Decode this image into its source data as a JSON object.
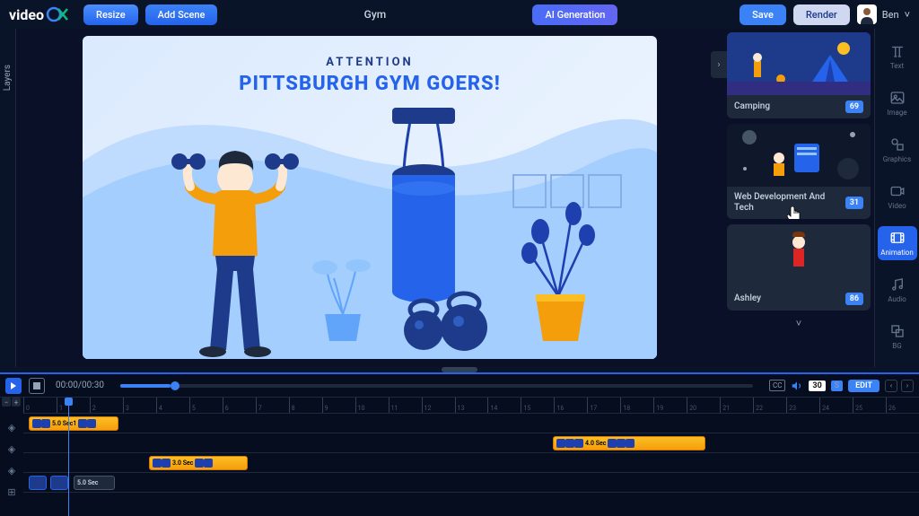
{
  "app": {
    "name": "video",
    "logoSuffix": "XQ"
  },
  "topbar": {
    "resize": "Resize",
    "addScene": "Add Scene",
    "projectTitle": "Gym",
    "aiGeneration": "AI Generation",
    "save": "Save",
    "render": "Render",
    "userName": "Ben"
  },
  "sidebar": {
    "layers": "Layers"
  },
  "canvas": {
    "line1": "ATTENTION",
    "line2": "PITTSBURGH GYM GOERS!"
  },
  "templates": [
    {
      "name": "Camping",
      "count": "69"
    },
    {
      "name": "Web Development And Tech",
      "count": "31"
    },
    {
      "name": "Ashley",
      "count": "86"
    }
  ],
  "tools": [
    {
      "id": "text",
      "label": "Text"
    },
    {
      "id": "image",
      "label": "Image"
    },
    {
      "id": "graphics",
      "label": "Graphics"
    },
    {
      "id": "video",
      "label": "Video"
    },
    {
      "id": "animation",
      "label": "Animation",
      "active": true
    },
    {
      "id": "audio",
      "label": "Audio"
    },
    {
      "id": "bg",
      "label": "BG"
    }
  ],
  "timeline": {
    "current": "00:00",
    "total": "00:30",
    "fps": "30",
    "fpsUnit": "S",
    "edit": "EDIT",
    "cc": "CC",
    "rulerMax": 27,
    "clips": [
      {
        "track": 0,
        "start": 0,
        "width": 100,
        "label": "5.0 Sec1"
      },
      {
        "track": 1,
        "start": 590,
        "width": 170,
        "label": "4.0 Sec"
      },
      {
        "track": 2,
        "start": 140,
        "width": 110,
        "label": "3.0 Sec"
      },
      {
        "track": 3,
        "start": 10,
        "width": 80,
        "label": "5.0 Sec",
        "audio": true
      }
    ]
  }
}
